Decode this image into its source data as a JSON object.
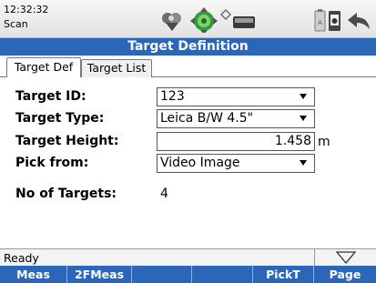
{
  "topbar": {
    "time": "12:32:32",
    "mode": "Scan",
    "icons": [
      "target-prism-icon",
      "tracking-target-icon",
      "wifi-icon",
      "battery-icon",
      "sd-card-icon",
      "phone-icon",
      "back-icon"
    ]
  },
  "title": "Target Definition",
  "tabs": [
    {
      "label": "Target Def",
      "active": true
    },
    {
      "label": "Target List",
      "active": false
    }
  ],
  "form": {
    "target_id": {
      "label": "Target ID:",
      "value": "123"
    },
    "target_type": {
      "label": "Target Type:",
      "value": "Leica B/W 4.5\""
    },
    "target_height": {
      "label": "Target Height:",
      "value": "1.458",
      "unit": "m"
    },
    "pick_from": {
      "label": "Pick from:",
      "value": "Video Image"
    },
    "no_of_targets": {
      "label": "No of Targets:",
      "value": "4"
    }
  },
  "status": {
    "text": "Ready",
    "expand_icon": "triangle-down-icon"
  },
  "softkeys": [
    "Meas",
    "2FMeas",
    "",
    "",
    "PickT",
    "Page"
  ],
  "colors": {
    "accent": "#2b66b8",
    "softkey_divider": "#8fb0e0"
  }
}
